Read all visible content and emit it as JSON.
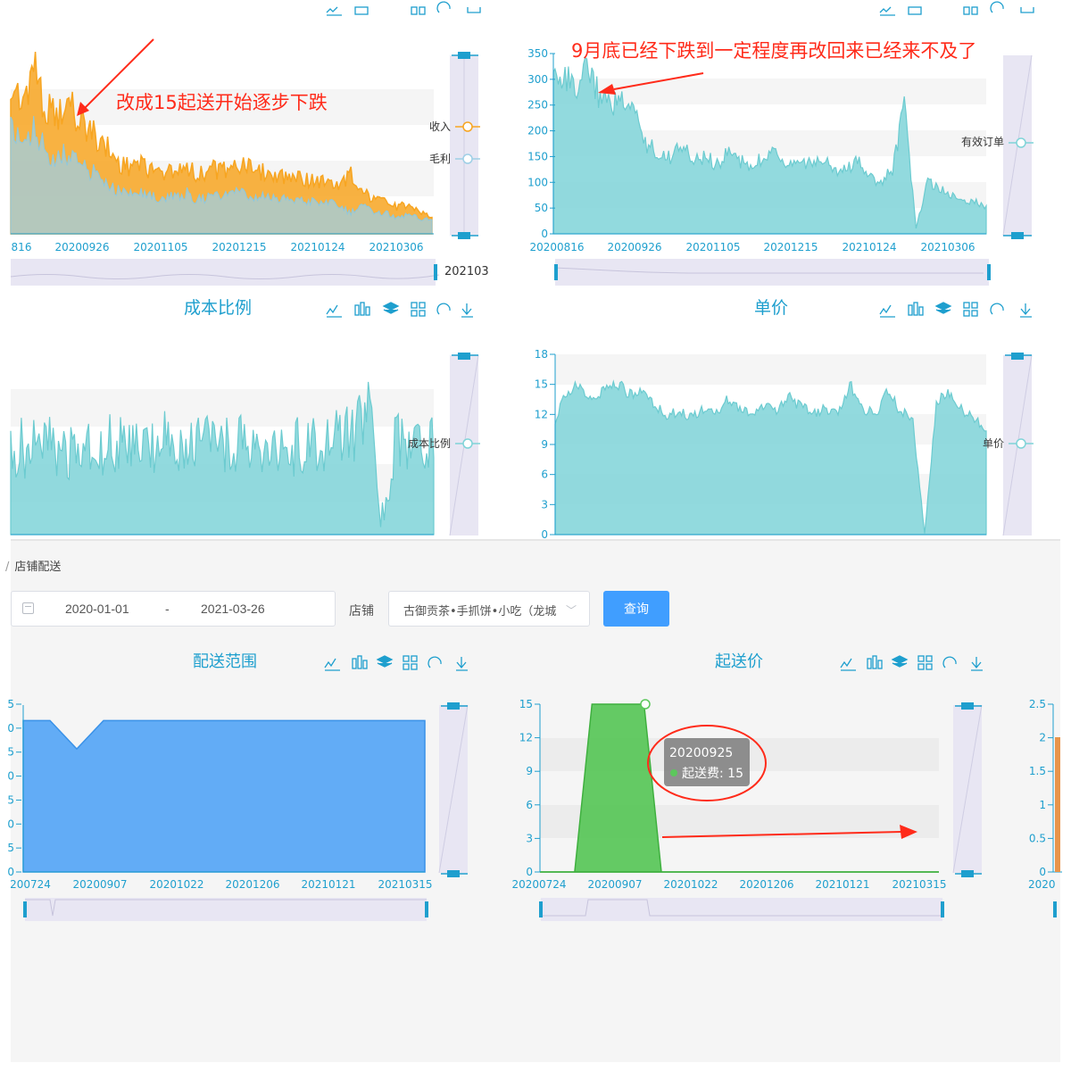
{
  "top_panels": {
    "revenue": {
      "x_ticks": [
        "816",
        "20200926",
        "20201105",
        "20201215",
        "20210124",
        "20210306"
      ],
      "legend": [
        "收入",
        "毛利"
      ],
      "zoom_label": "202103",
      "annotation": "改成15起送开始逐步下跌"
    },
    "orders": {
      "y_ticks": [
        "0",
        "50",
        "100",
        "150",
        "200",
        "250",
        "300",
        "350"
      ],
      "x_ticks": [
        "20200816",
        "20200926",
        "20201105",
        "20201215",
        "20210124",
        "20210306"
      ],
      "legend": [
        "有效订单"
      ],
      "annotation": "9月底已经下跌到一定程度再改回来已经来不及了"
    },
    "cost_ratio": {
      "title": "成本比例",
      "legend": [
        "成本比例"
      ]
    },
    "unit_price": {
      "title": "单价",
      "y_ticks": [
        "0",
        "3",
        "6",
        "9",
        "12",
        "15",
        "18"
      ],
      "legend": [
        "单价"
      ]
    }
  },
  "bottom": {
    "breadcrumb": "店铺配送",
    "date_start": "2020-01-01",
    "date_sep": "-",
    "date_end": "2021-03-26",
    "shop_label": "店铺",
    "shop_value": "古御贡茶•手抓饼•小吃（龙城",
    "query_button": "查询",
    "delivery_range": {
      "title": "配送范围",
      "y_ticks": [
        "0",
        "5",
        "0",
        "5",
        "0",
        "5",
        "0",
        "5"
      ],
      "x_ticks": [
        "200724",
        "20200907",
        "20201022",
        "20201206",
        "20210121",
        "20210315"
      ]
    },
    "min_price": {
      "title": "起送价",
      "y_ticks": [
        "0",
        "3",
        "6",
        "9",
        "12",
        "15"
      ],
      "x_ticks": [
        "20200724",
        "20200907",
        "20201022",
        "20201206",
        "20210121",
        "20210315"
      ],
      "tooltip_date": "20200925",
      "tooltip_value": "起送费: 15"
    },
    "third": {
      "y_ticks": [
        "0",
        "0.5",
        "1",
        "1.5",
        "2",
        "2.5"
      ],
      "x_ticks": [
        "2020"
      ]
    }
  },
  "colors": {
    "cyan": "#7fd4d8",
    "orange": "#f7a521",
    "light_blue": "#9ecfe6",
    "blue": "#5aa8f5",
    "green": "#5cc75c",
    "red": "#ff2b1a",
    "theme": "#1e9fce"
  },
  "chart_data": [
    {
      "type": "area",
      "title": "",
      "x_start": "2020-08-16",
      "x_end": "2021-03-26",
      "series": [
        {
          "name": "收入",
          "values": [
            620,
            560,
            700,
            520,
            480,
            550,
            460,
            420,
            380,
            300,
            280,
            310,
            260,
            250,
            270,
            290,
            240,
            270,
            260,
            300,
            280,
            250,
            260,
            240,
            250,
            230,
            220,
            210,
            200,
            250,
            180,
            140,
            130,
            110,
            120,
            90,
            70
          ]
        },
        {
          "name": "毛利",
          "values": [
            300,
            260,
            320,
            240,
            220,
            240,
            200,
            180,
            160,
            130,
            120,
            130,
            110,
            110,
            115,
            120,
            100,
            110,
            110,
            125,
            115,
            105,
            110,
            100,
            105,
            95,
            95,
            90,
            85,
            60,
            80,
            65,
            60,
            50,
            55,
            45,
            40
          ]
        }
      ]
    },
    {
      "type": "area",
      "title": "",
      "x_start": "2020-08-16",
      "x_end": "2021-03-26",
      "ylim": [
        0,
        350
      ],
      "series": [
        {
          "name": "有效订单",
          "values": [
            330,
            300,
            290,
            320,
            260,
            250,
            270,
            240,
            170,
            160,
            150,
            170,
            140,
            150,
            135,
            160,
            140,
            130,
            150,
            155,
            140,
            130,
            135,
            145,
            120,
            125,
            140,
            110,
            100,
            125,
            250,
            10,
            100,
            90,
            75,
            60,
            65,
            50
          ]
        }
      ]
    },
    {
      "type": "area",
      "title": "成本比例",
      "series": [
        {
          "name": "成本比例",
          "values": [
            0.48,
            0.49,
            0.47,
            0.5,
            0.49,
            0.48,
            0.5,
            0.49,
            0.51,
            0.48,
            0.5,
            0.49,
            0.62,
            0.52,
            0.5,
            0.51,
            0.49,
            0.5,
            0.52,
            0.5,
            0.51,
            0.5,
            0.49,
            0.5,
            0.51,
            0.52,
            0.55,
            0.58,
            0.72,
            0.01,
            0.53,
            0.52,
            0.5,
            0.51
          ]
        }
      ]
    },
    {
      "type": "area",
      "title": "单价",
      "ylim": [
        0,
        18
      ],
      "series": [
        {
          "name": "单价",
          "values": [
            11.5,
            14.5,
            14.8,
            13.8,
            14.2,
            15.2,
            14.0,
            14.5,
            13.2,
            12.0,
            12.3,
            11.8,
            12.5,
            12.0,
            13.5,
            12.4,
            12.2,
            13.0,
            12.5,
            13.8,
            12.7,
            12.0,
            12.6,
            12.3,
            15.0,
            12.5,
            12.0,
            14.5,
            12.2,
            11.8,
            0.1,
            13.5,
            14.0,
            12.5,
            11.5,
            10.5
          ]
        }
      ]
    },
    {
      "type": "area",
      "title": "配送范围",
      "x_start": "2020-07-24",
      "x_end": "2021-03-20",
      "series": [
        {
          "name": "配送范围",
          "values": [
            3.2,
            3.2,
            2.6,
            3.2,
            3.2,
            3.2,
            3.2,
            3.2,
            3.2,
            3.2,
            3.2,
            3.2,
            3.2,
            3.2,
            3.2,
            3.2
          ]
        }
      ]
    },
    {
      "type": "area",
      "title": "起送价",
      "x_start": "2020-07-24",
      "x_end": "2021-03-20",
      "ylim": [
        0,
        15
      ],
      "series": [
        {
          "name": "起送费",
          "values": [
            0,
            0,
            0,
            15,
            15,
            15,
            15,
            0,
            0,
            0,
            0,
            0,
            0,
            0,
            0,
            0,
            0,
            0,
            0,
            0,
            0,
            0,
            0,
            0
          ]
        }
      ]
    }
  ]
}
